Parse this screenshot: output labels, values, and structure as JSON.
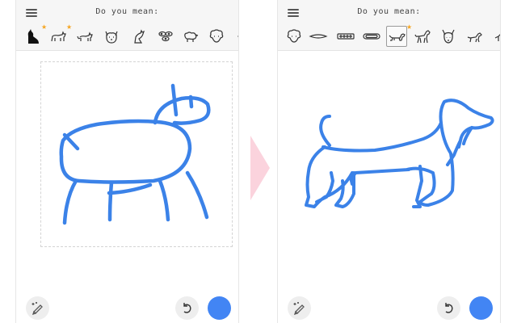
{
  "left_screen": {
    "prompt": "Do you mean:",
    "suggestions": [
      "cat-silhouette-icon",
      "cat-icon",
      "cat-icon",
      "cat-face-icon",
      "cat-icon",
      "bacteria-icon",
      "sheep-icon",
      "sheep-face-icon"
    ],
    "starred": [
      0,
      1
    ]
  },
  "right_screen": {
    "prompt": "Do you mean:",
    "suggestions": [
      "sheep-face-icon",
      "hotdog-icon",
      "hotdog-icon",
      "hotdog-icon",
      "dachshund-icon",
      "dog-icon",
      "dog-face-icon",
      "dog-icon"
    ],
    "starred": [
      4
    ],
    "selected": 4
  },
  "colors": {
    "stroke": "#3b82e8",
    "accent": "#4285f4",
    "star": "#f5a623",
    "arrow": "#fbd3dd"
  }
}
